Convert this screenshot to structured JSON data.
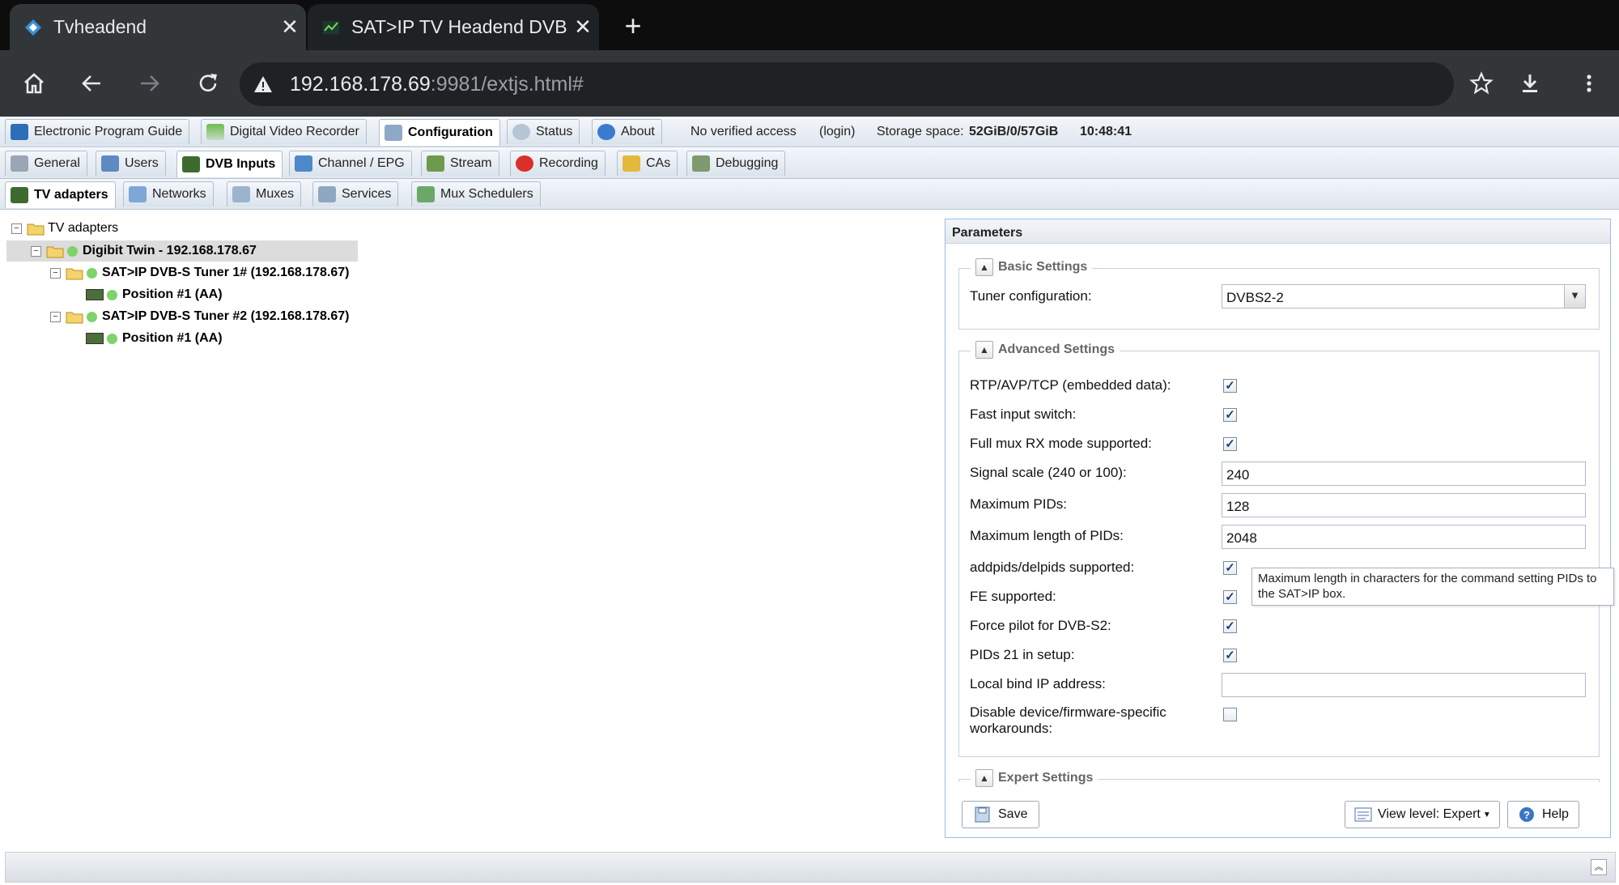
{
  "browser": {
    "tabs": [
      {
        "title": "Tvheadend",
        "active": true
      },
      {
        "title": "SAT>IP TV Headend DVB-",
        "active": false
      }
    ],
    "url_host": "192.168.178.69",
    "url_path": ":9981/extjs.html#"
  },
  "app": {
    "top_tabs": [
      {
        "label": "Electronic Program Guide",
        "icon": "epg-icon"
      },
      {
        "label": "Digital Video Recorder",
        "icon": "dvr-icon"
      },
      {
        "label": "Configuration",
        "icon": "wrench-icon"
      },
      {
        "label": "Status",
        "icon": "eye-icon"
      },
      {
        "label": "About",
        "icon": "info-icon"
      }
    ],
    "status": {
      "access": "No verified access",
      "login": "(login)",
      "storage_label": "Storage space:",
      "storage_value": "52GiB/0/57GiB",
      "time": "10:48:41"
    },
    "config_tabs": [
      {
        "label": "General"
      },
      {
        "label": "Users"
      },
      {
        "label": "DVB Inputs"
      },
      {
        "label": "Channel / EPG"
      },
      {
        "label": "Stream"
      },
      {
        "label": "Recording"
      },
      {
        "label": "CAs"
      },
      {
        "label": "Debugging"
      }
    ],
    "dvb_tabs": [
      {
        "label": "TV adapters"
      },
      {
        "label": "Networks"
      },
      {
        "label": "Muxes"
      },
      {
        "label": "Services"
      },
      {
        "label": "Mux Schedulers"
      }
    ],
    "tree": {
      "root": "TV adapters",
      "device": "Digibit Twin - 192.168.178.67",
      "tuner1": "SAT>IP DVB-S Tuner 1# (192.168.178.67)",
      "tuner1_pos": "Position #1 (AA)",
      "tuner2": "SAT>IP DVB-S Tuner #2 (192.168.178.67)",
      "tuner2_pos": "Position #1 (AA)"
    },
    "params": {
      "title": "Parameters",
      "basic_title": "Basic Settings",
      "tuner_config_label": "Tuner configuration:",
      "tuner_config_value": "DVBS2-2",
      "advanced_title": "Advanced Settings",
      "rtp_label": "RTP/AVP/TCP (embedded data):",
      "fast_switch_label": "Fast input switch:",
      "full_mux_label": "Full mux RX mode supported:",
      "signal_scale_label": "Signal scale (240 or 100):",
      "signal_scale_value": "240",
      "max_pids_label": "Maximum PIDs:",
      "max_pids_value": "128",
      "max_pid_len_label": "Maximum length of PIDs:",
      "max_pid_len_value": "2048",
      "addpids_label": "addpids/delpids supported:",
      "fe_label": "FE supported:",
      "force_pilot_label": "Force pilot for DVB-S2:",
      "pids21_label": "PIDs 21 in setup:",
      "bind_ip_label": "Local bind IP address:",
      "bind_ip_value": "",
      "disable_workarounds_label": "Disable device/firmware-specific workarounds:",
      "expert_title": "Expert Settings",
      "tooltip": "Maximum length in characters for the command setting PIDs to the SAT>IP box.",
      "save_label": "Save",
      "view_level_label": "View level: Expert",
      "help_label": "Help"
    }
  }
}
